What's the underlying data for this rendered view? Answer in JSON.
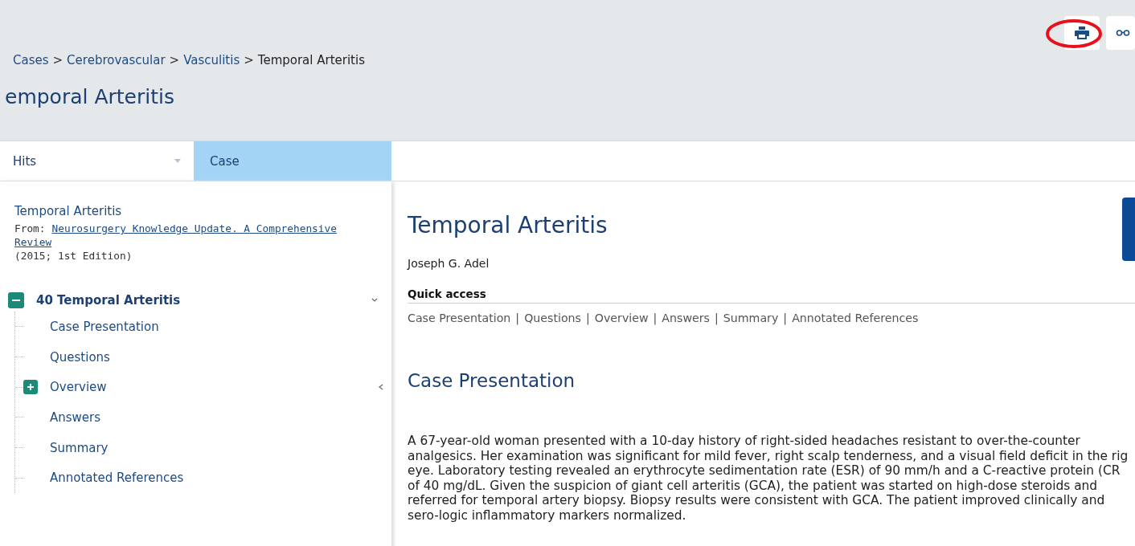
{
  "header": {
    "breadcrumb": [
      {
        "label": "Cases",
        "current": false
      },
      {
        "label": "Cerebrovascular",
        "current": false
      },
      {
        "label": "Vasculitis",
        "current": false
      },
      {
        "label": "Temporal Arteritis",
        "current": true
      }
    ],
    "breadcrumb_separator": ">",
    "title": "emporal Arteritis"
  },
  "tabs": [
    {
      "label": "Hits",
      "selected": false,
      "kind": "dropdown"
    },
    {
      "label": "Case",
      "selected": true,
      "kind": "plain"
    }
  ],
  "sidebar": {
    "title": "Temporal Arteritis",
    "from_label": "From:",
    "source_link_lines": [
      "Neurosurgery Knowledge Update. A Comprehensive",
      "Review"
    ],
    "edition": "(2015; 1st Edition)",
    "tree": [
      {
        "label": "40 Temporal Arteritis",
        "expanded": true,
        "children": [
          {
            "label": "Case Presentation"
          },
          {
            "label": "Questions"
          },
          {
            "label": "Overview",
            "expanded": false
          },
          {
            "label": "Answers"
          },
          {
            "label": "Summary"
          },
          {
            "label": "Annotated References"
          }
        ]
      }
    ]
  },
  "article": {
    "title": "Temporal Arteritis",
    "author": "Joseph G. Adel",
    "quick_access_heading": "Quick access",
    "separator": "|",
    "quick_links": [
      "Case Presentation",
      "Questions",
      "Overview",
      "Answers",
      "Summary",
      "Annotated References"
    ],
    "section_heading": "Case Presentation",
    "paragraph_lines": [
      "A 67-year-old woman presented with a 10-day history of right-sided headaches resistant to over-the-counter",
      "analgesics. Her examination was significant for mild fever, right scalp tenderness, and a visual field deficit in the rig",
      "eye. Laboratory testing revealed an erythrocyte sedimentation rate (ESR) of 90 mm/h and a C-reactive protein (CR",
      "of 40 mg/dL. Given the suspicion of giant cell arteritis (GCA), the patient was started on high-dose steroids and",
      "referred for temporal artery biopsy. Biopsy results were consistent with GCA. The patient improved clinically and",
      "sero-logic inflammatory markers normalized."
    ]
  }
}
